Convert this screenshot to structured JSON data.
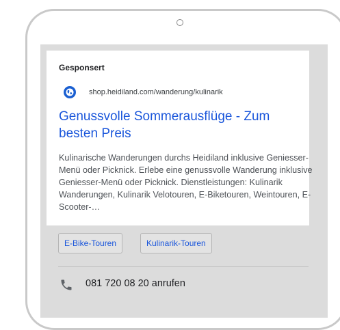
{
  "ad": {
    "sponsored_label": "Gesponsert",
    "display_url": "shop.heidiland.com/wanderung/kulinarik",
    "headline": "Genussvolle Sommerausflüge - Zum besten Preis",
    "description": "Kulinarische Wanderungen durchs Heidiland inklusive Geniesser-Menü oder Picknick. Erlebe eine genussvolle Wanderung inklusive Geniesser-Menü oder Picknick. Dienstleistungen: Kulinarik Wanderungen, Kulinarik Velotouren, E-Biketouren, Weintouren, E-Scooter-…",
    "sitelinks": [
      {
        "label": "E-Bike-Touren"
      },
      {
        "label": "Kulinarik-Touren"
      }
    ],
    "call": {
      "label": "081 720 08 20 anrufen"
    }
  },
  "colors": {
    "link_blue": "#1a56db",
    "favicon_blue": "#1a5fd1",
    "screen_gray": "#dcdcdc"
  },
  "icons": {
    "favicon": "globe-icon",
    "call": "phone-icon"
  }
}
